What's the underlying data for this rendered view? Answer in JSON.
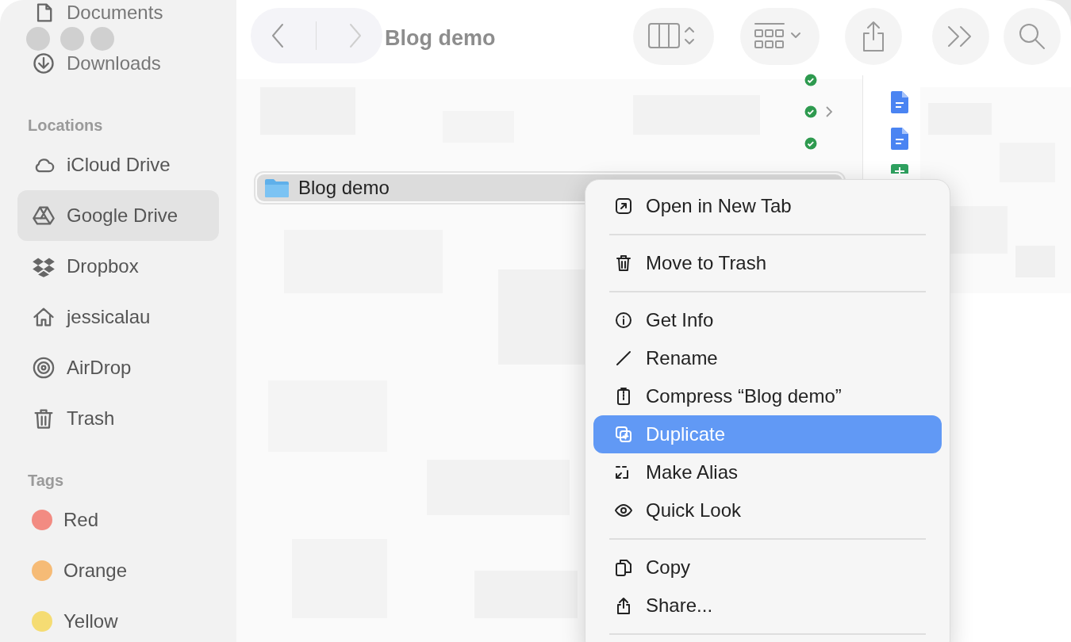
{
  "window": {
    "title": "Blog demo"
  },
  "navigation": {
    "back_disabled": false,
    "forward_disabled": true
  },
  "sidebar": {
    "sections": [
      {
        "items": [
          {
            "label": "Documents",
            "selected": false
          },
          {
            "label": "Downloads",
            "selected": false
          }
        ]
      },
      {
        "header": "Locations",
        "items": [
          {
            "label": "iCloud Drive",
            "selected": false
          },
          {
            "label": "Google Drive",
            "selected": true
          },
          {
            "label": "Dropbox",
            "selected": false
          },
          {
            "label": "jessicalau",
            "selected": false
          },
          {
            "label": "AirDrop",
            "selected": false
          },
          {
            "label": "Trash",
            "selected": false
          }
        ]
      },
      {
        "header": "Tags",
        "items": [
          {
            "label": "Red",
            "color": "#f28b82",
            "selected": false
          },
          {
            "label": "Orange",
            "color": "#f6bb76",
            "selected": false
          },
          {
            "label": "Yellow",
            "color": "#f5dc73",
            "selected": false
          }
        ]
      }
    ]
  },
  "file_list": {
    "selected_row": {
      "name": "Blog demo",
      "selected": true
    }
  },
  "context_menu": {
    "items": [
      {
        "kind": "item",
        "label": "Open in New Tab",
        "selected": false
      },
      {
        "kind": "separator"
      },
      {
        "kind": "item",
        "label": "Move to Trash",
        "selected": false
      },
      {
        "kind": "separator"
      },
      {
        "kind": "item",
        "label": "Get Info",
        "selected": false
      },
      {
        "kind": "item",
        "label": "Rename",
        "selected": false
      },
      {
        "kind": "item",
        "label": "Compress “Blog demo”",
        "selected": false
      },
      {
        "kind": "item",
        "label": "Duplicate",
        "selected": true
      },
      {
        "kind": "item",
        "label": "Make Alias",
        "selected": false
      },
      {
        "kind": "item",
        "label": "Quick Look",
        "selected": false
      },
      {
        "kind": "separator"
      },
      {
        "kind": "item",
        "label": "Copy",
        "selected": false
      },
      {
        "kind": "item",
        "label": "Share...",
        "selected": false
      },
      {
        "kind": "separator"
      }
    ]
  }
}
